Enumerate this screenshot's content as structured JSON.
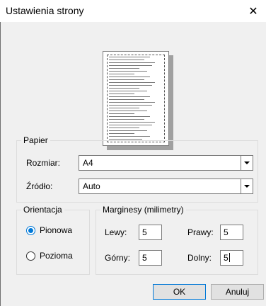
{
  "window": {
    "title": "Ustawienia strony",
    "close_glyph": "✕"
  },
  "paper": {
    "group_label": "Papier",
    "size_label": "Rozmiar:",
    "size_value": "A4",
    "source_label": "Źródło:",
    "source_value": "Auto"
  },
  "orientation": {
    "group_label": "Orientacja",
    "portrait_label": "Pionowa",
    "landscape_label": "Pozioma",
    "selected": "portrait"
  },
  "margins": {
    "group_label": "Marginesy (milimetry)",
    "left_label": "Lewy:",
    "left_value": "5",
    "right_label": "Prawy:",
    "right_value": "5",
    "top_label": "Górny:",
    "top_value": "5",
    "bottom_label": "Dolny:",
    "bottom_value": "5"
  },
  "buttons": {
    "ok_label": "OK",
    "cancel_label": "Anuluj"
  },
  "colors": {
    "accent": "#0078d7",
    "dialog_bg": "#f0f0f0"
  }
}
